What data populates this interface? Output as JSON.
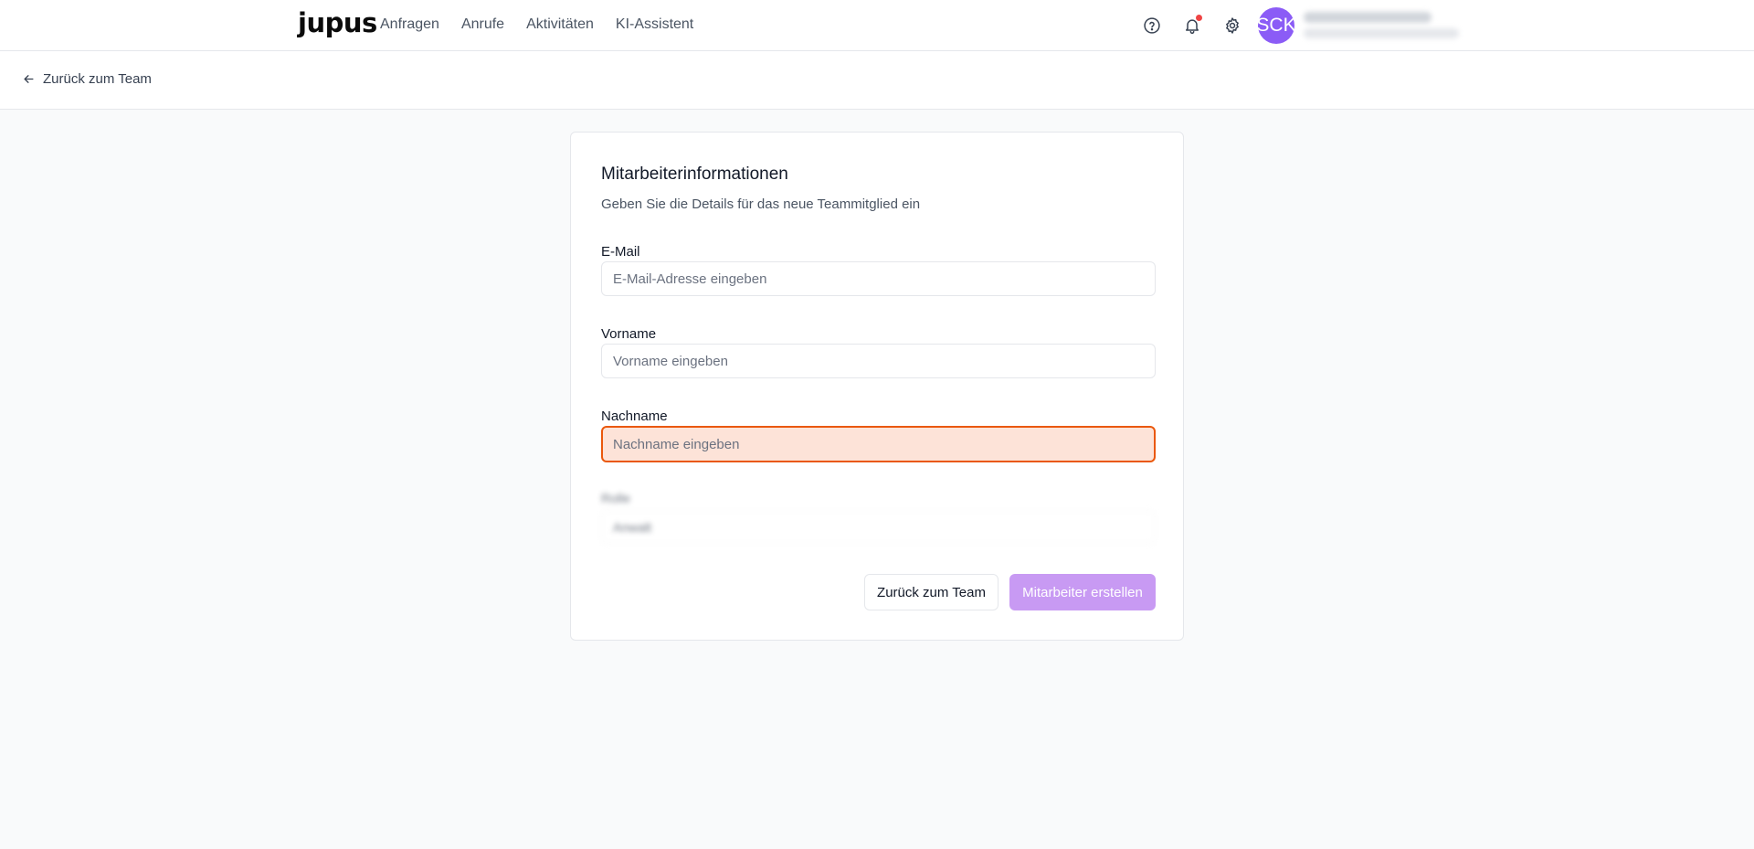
{
  "app": {
    "logo": "jupus"
  },
  "nav": {
    "items": [
      "Anfragen",
      "Anrufe",
      "Aktivitäten",
      "KI-Assistent"
    ]
  },
  "header": {
    "icons": [
      "help-circle-icon",
      "bell-icon",
      "gear-icon"
    ],
    "avatar_initials": "SCK",
    "notification_color": "#ef4444",
    "avatar_color": "#8b5cf6"
  },
  "subbar": {
    "back_label": "Zurück zum Team"
  },
  "form": {
    "title": "Mitarbeiterinformationen",
    "description": "Geben Sie die Details für das neue Teammitglied ein",
    "email": {
      "label": "E-Mail",
      "placeholder": "E-Mail-Adresse eingeben",
      "value": ""
    },
    "first_name": {
      "label": "Vorname",
      "placeholder": "Vorname eingeben",
      "value": ""
    },
    "last_name": {
      "label": "Nachname",
      "placeholder": "Nachname eingeben",
      "value": "",
      "focused": true
    },
    "role": {
      "label": "Rolle",
      "selected": "Anwalt"
    },
    "cancel_label": "Zurück zum Team",
    "submit_label": "Mitarbeiter erstellen"
  },
  "colors": {
    "accent": "#c89af3",
    "focus_border": "#ea580c",
    "focus_bg": "#fde3d8"
  }
}
